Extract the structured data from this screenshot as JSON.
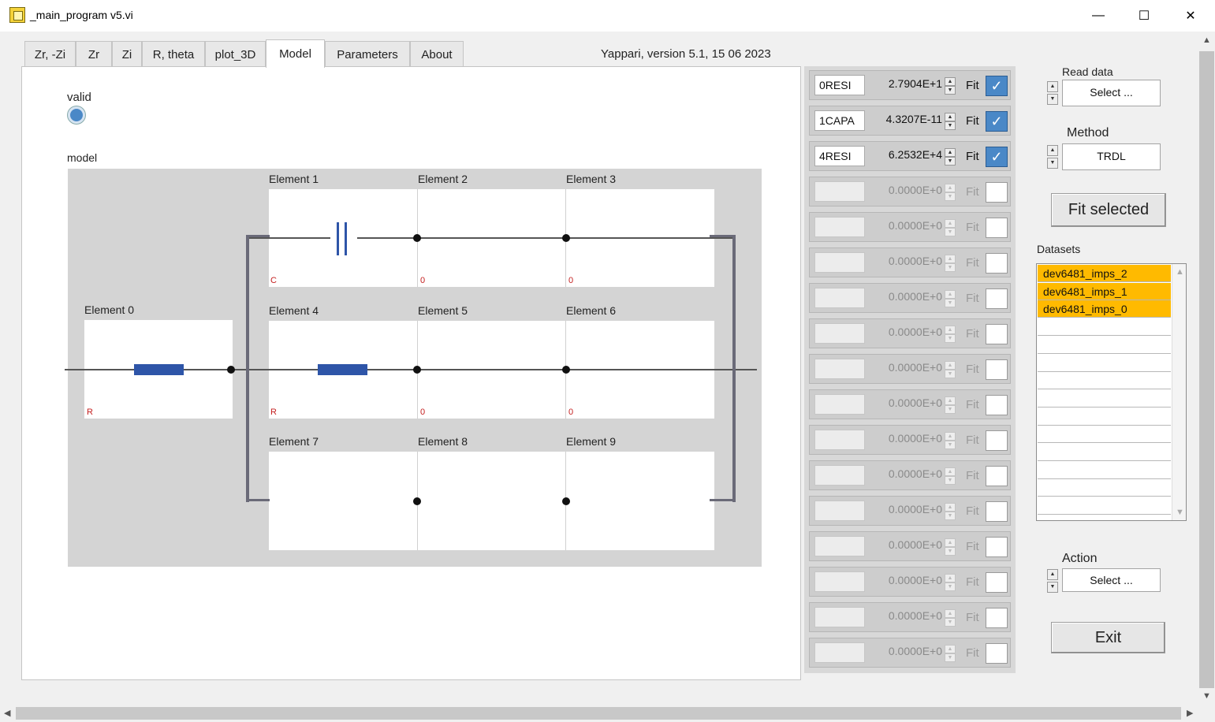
{
  "window": {
    "title": "_main_program v5.vi",
    "minimize": "—",
    "maximize": "☐",
    "close": "✕"
  },
  "tabs": [
    {
      "label": "Zr, -Zi",
      "active": false
    },
    {
      "label": "Zr",
      "active": false
    },
    {
      "label": "Zi",
      "active": false
    },
    {
      "label": "R, theta",
      "active": false
    },
    {
      "label": "plot_3D",
      "active": false
    },
    {
      "label": "Model",
      "active": true
    },
    {
      "label": "Parameters",
      "active": false
    },
    {
      "label": "About",
      "active": false
    }
  ],
  "version_text": "Yappari, version 5.1, 15 06 2023",
  "model_panel": {
    "valid_label": "valid",
    "model_label": "model",
    "elements": [
      {
        "label": "Element 0",
        "tag": "R"
      },
      {
        "label": "Element 1",
        "tag": "C"
      },
      {
        "label": "Element 2",
        "tag": "0"
      },
      {
        "label": "Element 3",
        "tag": "0"
      },
      {
        "label": "Element 4",
        "tag": "R"
      },
      {
        "label": "Element 5",
        "tag": "0"
      },
      {
        "label": "Element 6",
        "tag": "0"
      },
      {
        "label": "Element 7",
        "tag": ""
      },
      {
        "label": "Element 8",
        "tag": ""
      },
      {
        "label": "Element 9",
        "tag": ""
      }
    ]
  },
  "parameters": [
    {
      "name": "0RESI",
      "value": "2.7904E+1",
      "fit_label": "Fit",
      "fit": true,
      "enabled": true
    },
    {
      "name": "1CAPA",
      "value": "4.3207E-11",
      "fit_label": "Fit",
      "fit": true,
      "enabled": true
    },
    {
      "name": "4RESI",
      "value": "6.2532E+4",
      "fit_label": "Fit",
      "fit": true,
      "enabled": true
    },
    {
      "name": "",
      "value": "0.0000E+0",
      "fit_label": "Fit",
      "fit": false,
      "enabled": false
    },
    {
      "name": "",
      "value": "0.0000E+0",
      "fit_label": "Fit",
      "fit": false,
      "enabled": false
    },
    {
      "name": "",
      "value": "0.0000E+0",
      "fit_label": "Fit",
      "fit": false,
      "enabled": false
    },
    {
      "name": "",
      "value": "0.0000E+0",
      "fit_label": "Fit",
      "fit": false,
      "enabled": false
    },
    {
      "name": "",
      "value": "0.0000E+0",
      "fit_label": "Fit",
      "fit": false,
      "enabled": false
    },
    {
      "name": "",
      "value": "0.0000E+0",
      "fit_label": "Fit",
      "fit": false,
      "enabled": false
    },
    {
      "name": "",
      "value": "0.0000E+0",
      "fit_label": "Fit",
      "fit": false,
      "enabled": false
    },
    {
      "name": "",
      "value": "0.0000E+0",
      "fit_label": "Fit",
      "fit": false,
      "enabled": false
    },
    {
      "name": "",
      "value": "0.0000E+0",
      "fit_label": "Fit",
      "fit": false,
      "enabled": false
    },
    {
      "name": "",
      "value": "0.0000E+0",
      "fit_label": "Fit",
      "fit": false,
      "enabled": false
    },
    {
      "name": "",
      "value": "0.0000E+0",
      "fit_label": "Fit",
      "fit": false,
      "enabled": false
    },
    {
      "name": "",
      "value": "0.0000E+0",
      "fit_label": "Fit",
      "fit": false,
      "enabled": false
    },
    {
      "name": "",
      "value": "0.0000E+0",
      "fit_label": "Fit",
      "fit": false,
      "enabled": false
    },
    {
      "name": "",
      "value": "0.0000E+0",
      "fit_label": "Fit",
      "fit": false,
      "enabled": false
    }
  ],
  "controls": {
    "read_data_label": "Read data",
    "read_data_value": "Select ...",
    "method_label": "Method",
    "method_value": "TRDL",
    "fit_selected_label": "Fit selected",
    "datasets_label": "Datasets",
    "datasets": [
      "dev6481_imps_2",
      "dev6481_imps_1",
      "dev6481_imps_0"
    ],
    "action_label": "Action",
    "action_value": "Select ...",
    "exit_label": "Exit"
  },
  "colors": {
    "selected_dataset": "#ffba00",
    "checkbox_on": "#4a88c7",
    "resistor": "#2e55a8",
    "tag_text": "#c42020"
  },
  "icons": {
    "app": "labview-vi-icon",
    "scroll_up": "▲",
    "scroll_down": "▼",
    "scroll_left": "◀",
    "scroll_right": "▶",
    "spin_up": "▲",
    "spin_down": "▼",
    "check": "✓"
  }
}
